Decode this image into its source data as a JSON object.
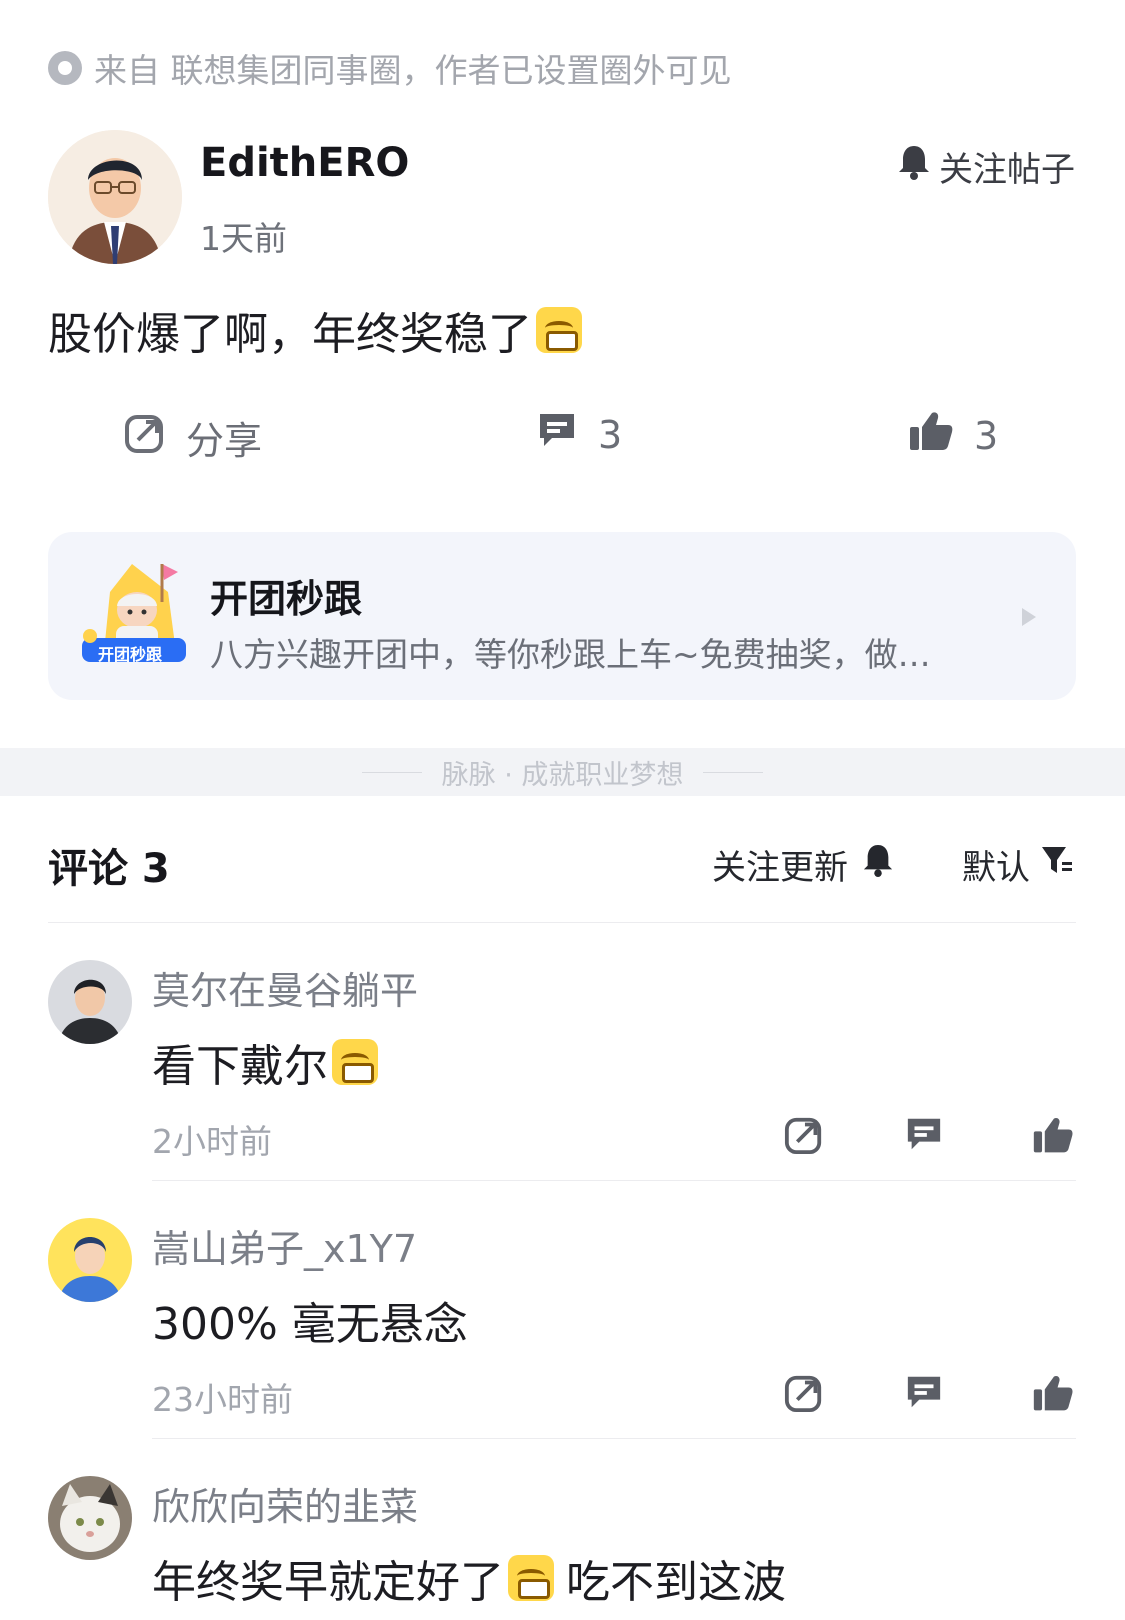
{
  "source": {
    "text": "来自 联想集团同事圈，作者已设置圈外可见"
  },
  "author": {
    "name": "EdithERO",
    "time": "1天前",
    "follow_label": "关注帖子"
  },
  "post": {
    "text": "股价爆了啊，年终奖稳了"
  },
  "actions": {
    "share_label": "分享",
    "comment_count": "3",
    "like_count": "3"
  },
  "promo": {
    "badge": "开团秒跟",
    "title": "开团秒跟",
    "desc": "八方兴趣开团中，等你秒跟上车~免费抽奖，做…"
  },
  "slogan": "脉脉 · 成就职业梦想",
  "comments_header": {
    "title": "评论 3",
    "follow_label": "关注更新",
    "sort_label": "默认"
  },
  "comments": [
    {
      "name": "莫尔在曼谷躺平",
      "text": "看下戴尔",
      "time": "2小时前"
    },
    {
      "name": "嵩山弟子_x1Y7",
      "text": "300% 毫无悬念",
      "time": "23小时前"
    },
    {
      "name": "欣欣向荣的韭菜",
      "text": "年终奖早就定好了",
      "text_after": "吃不到这波",
      "time": ""
    }
  ],
  "colors": {
    "accent": "#2a6df4",
    "promo_bg": "#f3f5fb",
    "muted": "#a2a6ae"
  }
}
